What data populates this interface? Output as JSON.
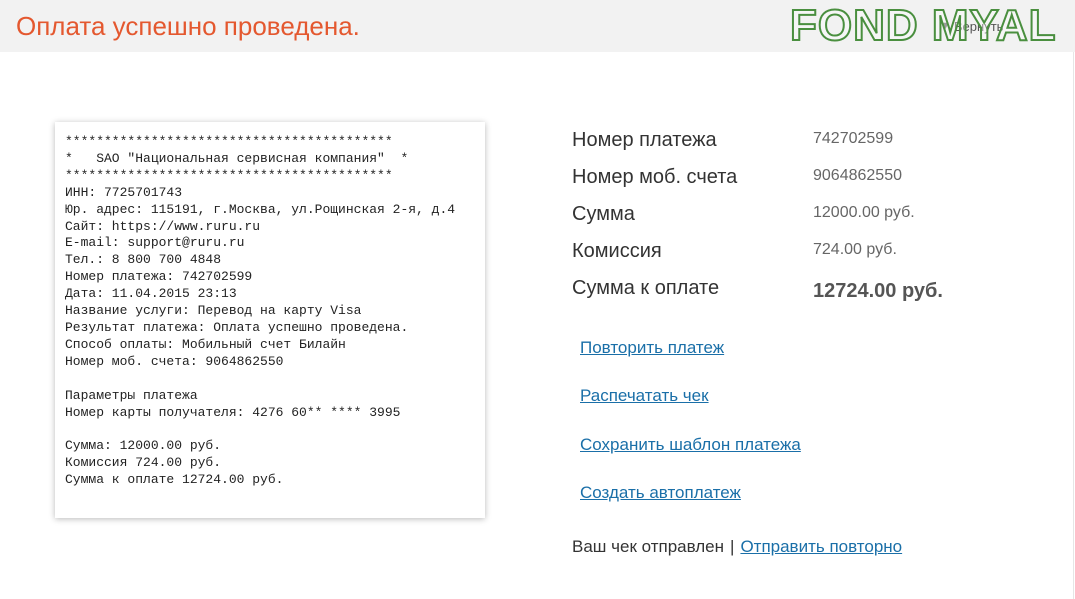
{
  "header": {
    "title": "Оплата успешно проведена.",
    "back_label": "Вернуть",
    "watermark": "FOND MYAL"
  },
  "receipt": {
    "text": "******************************************\n*   SAO \"Национальная сервисная компания\"  *\n******************************************\nИНН: 7725701743\nЮр. адрес: 115191, г.Москва, ул.Рощинская 2-я, д.4\nСайт: https://www.ruru.ru\nE-mail: support@ruru.ru\nТел.: 8 800 700 4848\nНомер платежа: 742702599\nДата: 11.04.2015 23:13\nНазвание услуги: Перевод на карту Visa\nРезультат платежа: Оплата успешно проведена.\nСпособ оплаты: Мобильный счет Билайн\nНомер моб. счета: 9064862550\n\nПараметры платежа\nНомер карты получателя: 4276 60** **** 3995\n\nСумма: 12000.00 руб.\nКомиссия 724.00 руб.\nСумма к оплате 12724.00 руб."
  },
  "details": [
    {
      "label": "Номер платежа",
      "value": "742702599"
    },
    {
      "label": "Номер моб. счета",
      "value": "9064862550"
    },
    {
      "label": "Сумма",
      "value": "12000.00 руб."
    },
    {
      "label": "Комиссия",
      "value": "724.00 руб."
    },
    {
      "label": "Сумма к оплате",
      "value": "12724.00 руб."
    }
  ],
  "actions": {
    "repeat": "Повторить платеж",
    "print": "Распечатать чек",
    "save_template": "Сохранить шаблон платежа",
    "autopay": "Создать автоплатеж"
  },
  "receipt_status": {
    "text": "Ваш чек отправлен",
    "separator": "|",
    "resend": "Отправить повторно"
  },
  "colors": {
    "title": "#e4582f",
    "link": "#1a6fa8",
    "watermark_outline": "#4a8f3f"
  },
  "icons": {
    "back": "chevron-down-icon"
  }
}
